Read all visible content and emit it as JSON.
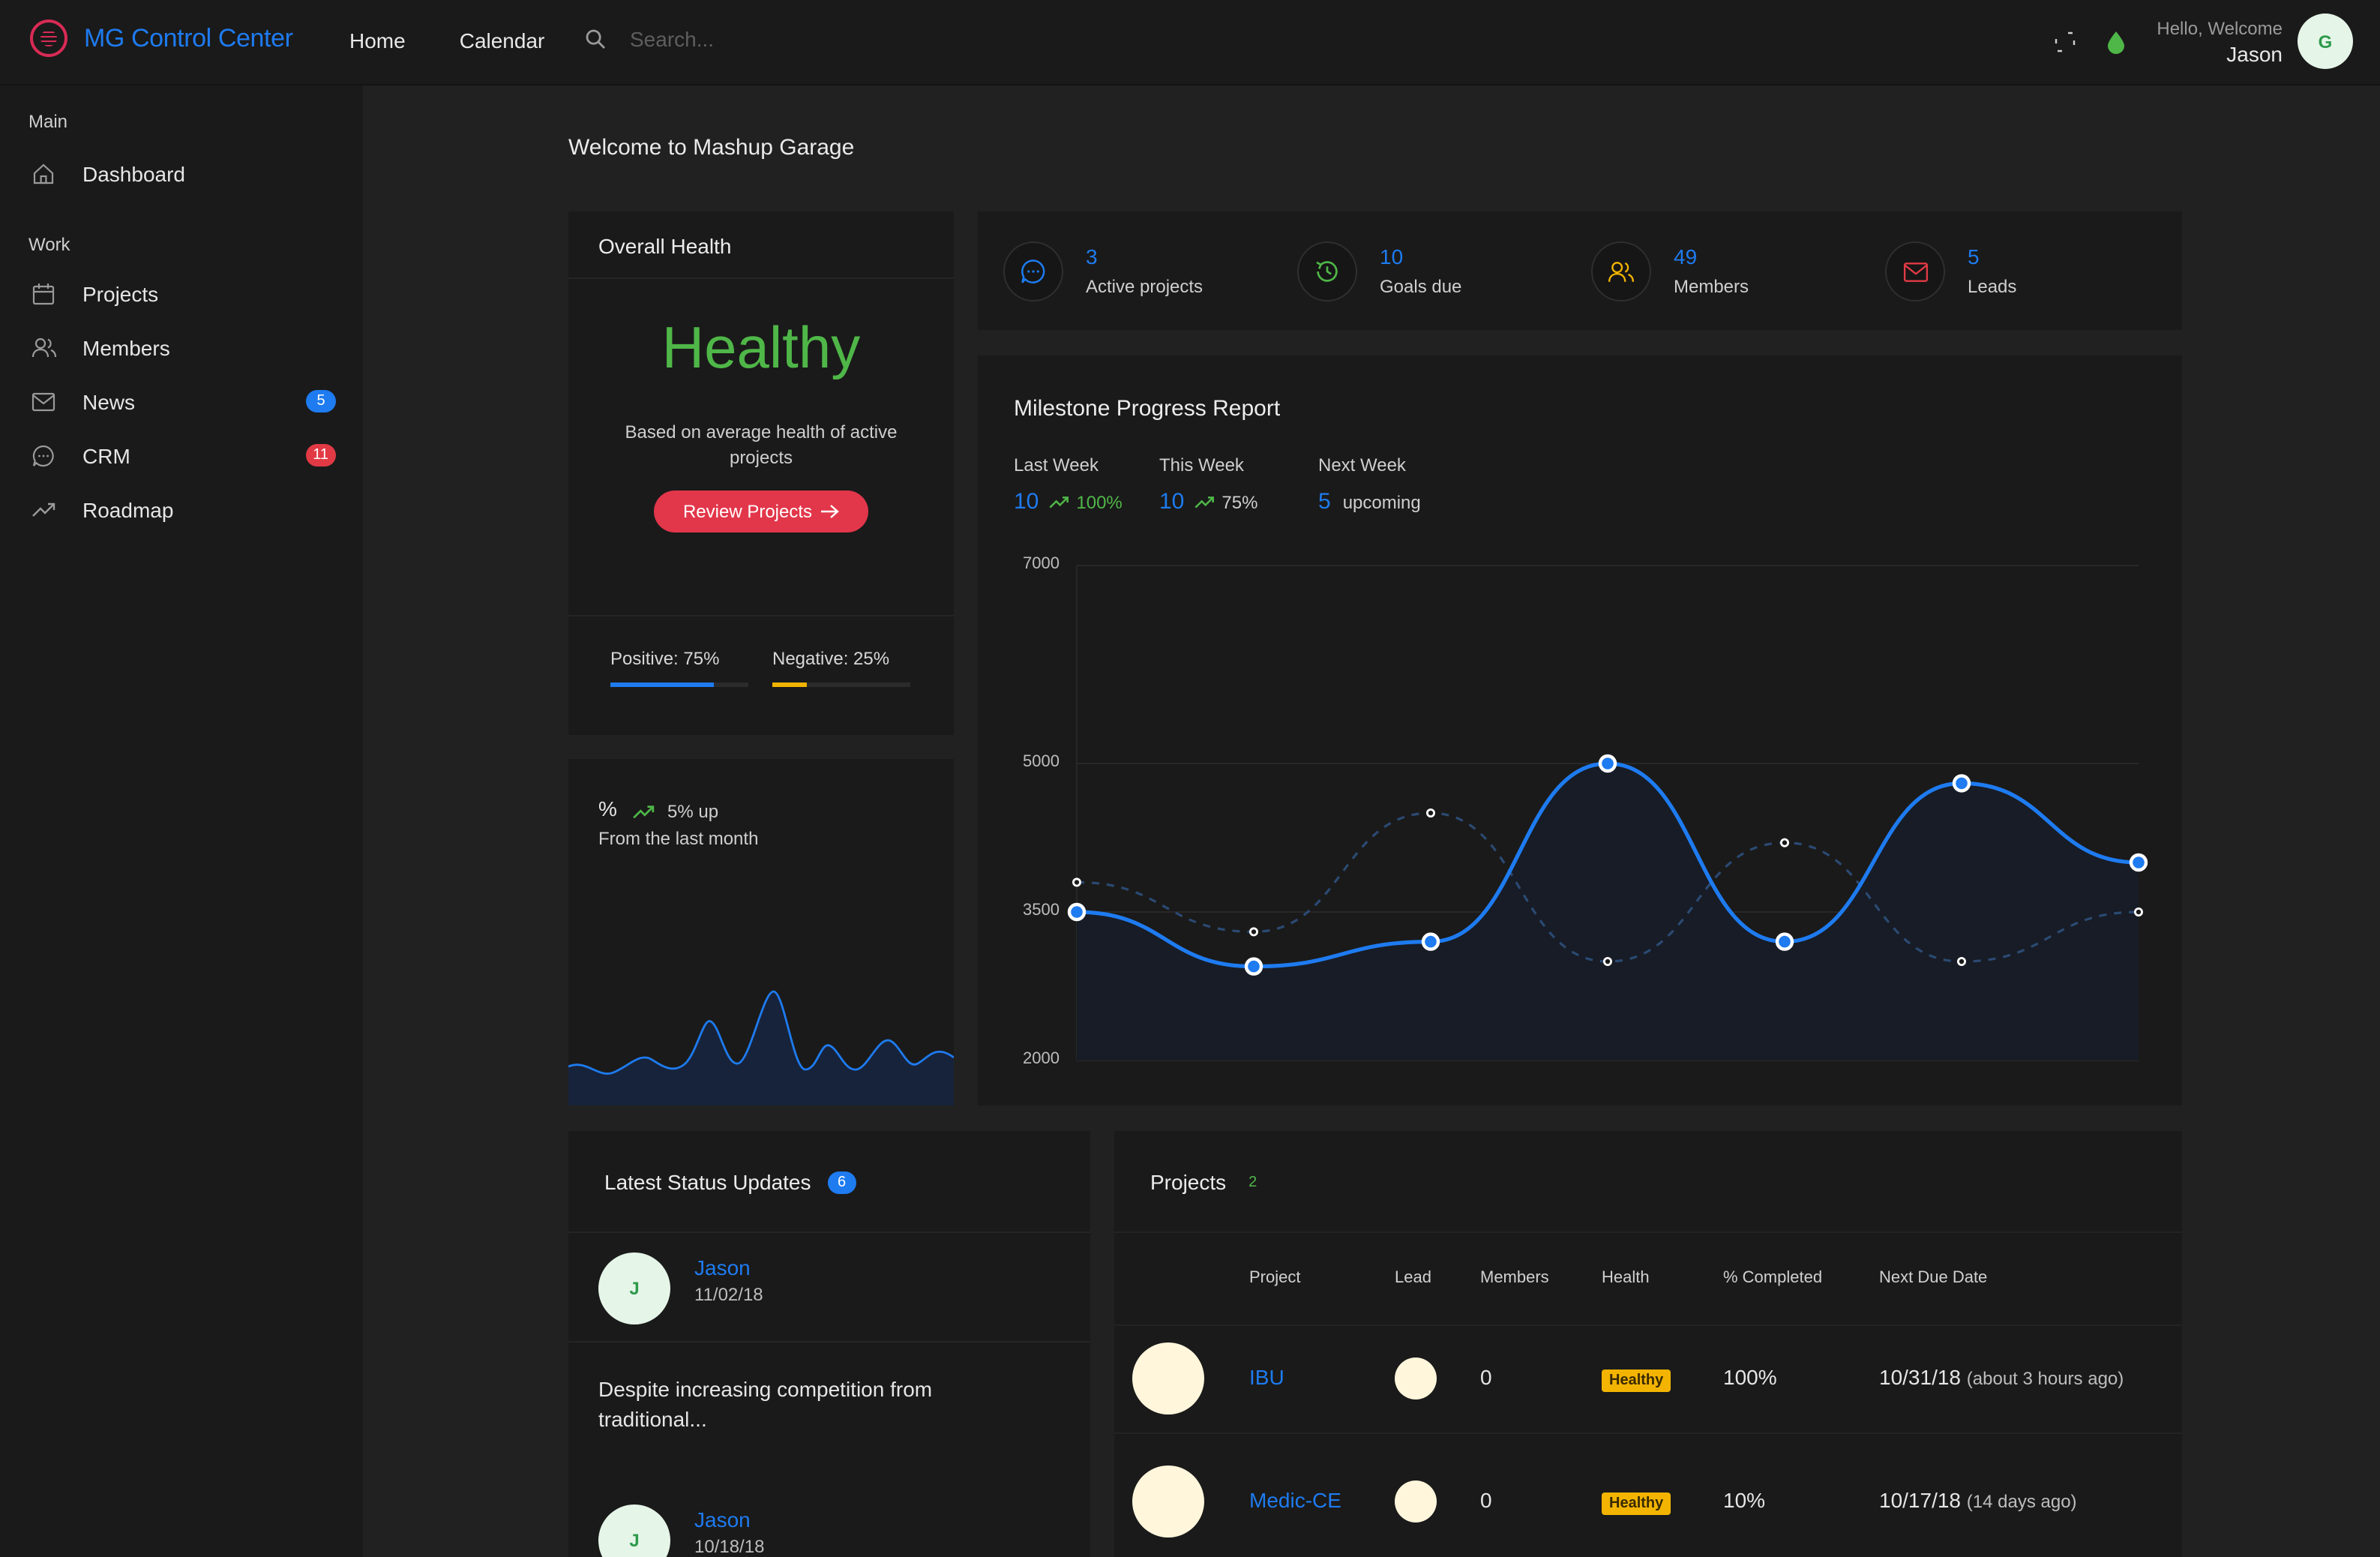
{
  "app": {
    "title": "MG Control Center"
  },
  "topnav": {
    "home": "Home",
    "calendar": "Calendar"
  },
  "search": {
    "placeholder": "Search..."
  },
  "user": {
    "greeting": "Hello, Welcome",
    "name": "Jason",
    "initial": "G"
  },
  "sidebar": {
    "main_heading": "Main",
    "work_heading": "Work",
    "items": [
      {
        "label": "Dashboard",
        "icon": "home-icon"
      },
      {
        "label": "Projects",
        "icon": "calendar-icon"
      },
      {
        "label": "Members",
        "icon": "users-icon"
      },
      {
        "label": "News",
        "icon": "mail-icon",
        "badge": "5",
        "badge_color": "#1e7bf0"
      },
      {
        "label": "CRM",
        "icon": "chat-icon",
        "badge": "11",
        "badge_color": "#e23a45"
      },
      {
        "label": "Roadmap",
        "icon": "trending-icon"
      }
    ]
  },
  "page": {
    "welcome": "Welcome to Mashup Garage"
  },
  "health": {
    "title": "Overall Health",
    "status": "Healthy",
    "description": "Based on average health of active projects",
    "button": "Review Projects",
    "positive_label": "Positive: 75%",
    "positive_value": 0.75,
    "negative_label": "Negative: 25%",
    "negative_value": 0.25
  },
  "stats": [
    {
      "value": "3",
      "label": "Active projects",
      "icon": "chat-icon",
      "color": "#1e7bf0"
    },
    {
      "value": "10",
      "label": "Goals due",
      "icon": "history-icon",
      "color": "#4fb748"
    },
    {
      "value": "49",
      "label": "Members",
      "icon": "users-icon",
      "color": "#f2b400"
    },
    {
      "value": "5",
      "label": "Leads",
      "icon": "mail-icon",
      "color": "#e23a45"
    }
  ],
  "milestone": {
    "title": "Milestone Progress Report",
    "last_week": {
      "label": "Last Week",
      "value": "10",
      "pct": "100%"
    },
    "this_week": {
      "label": "This Week",
      "value": "10",
      "pct": "75%"
    },
    "next_week": {
      "label": "Next Week",
      "value": "5",
      "note": "upcoming"
    }
  },
  "chart_data": {
    "type": "line",
    "yticks": [
      "7000",
      "5000",
      "3500",
      "2000"
    ],
    "ylim": [
      2000,
      7000
    ],
    "series": [
      {
        "values": [
          3500,
          2950,
          3200,
          5000,
          3200,
          4800,
          4000
        ],
        "style": "solid",
        "color": "#1e7bf0"
      },
      {
        "values": [
          3800,
          3300,
          4500,
          3000,
          4200,
          3000,
          3500
        ],
        "style": "dashed",
        "color": "#2b4a73"
      }
    ]
  },
  "trend": {
    "symbol": "%",
    "up_text": "5% up",
    "subtitle": "From the last month"
  },
  "status_updates": {
    "title": "Latest Status Updates",
    "count": "6",
    "entries": [
      {
        "initial": "J",
        "name": "Jason",
        "date": "11/02/18",
        "text": "Despite increasing competition from traditional..."
      },
      {
        "initial": "J",
        "name": "Jason",
        "date": "10/18/18"
      }
    ]
  },
  "projects": {
    "title": "Projects",
    "count": "2",
    "columns": [
      "Project",
      "Lead",
      "Members",
      "Health",
      "% Completed",
      "Next Due Date"
    ],
    "rows": [
      {
        "name": "IBU",
        "members": "0",
        "health": "Healthy",
        "completed": "100%",
        "due": "10/31/18",
        "ago": "(about 3 hours ago)"
      },
      {
        "name": "Medic-CE",
        "members": "0",
        "health": "Healthy",
        "completed": "10%",
        "due": "10/17/18",
        "ago": "(14 days ago)"
      }
    ]
  }
}
